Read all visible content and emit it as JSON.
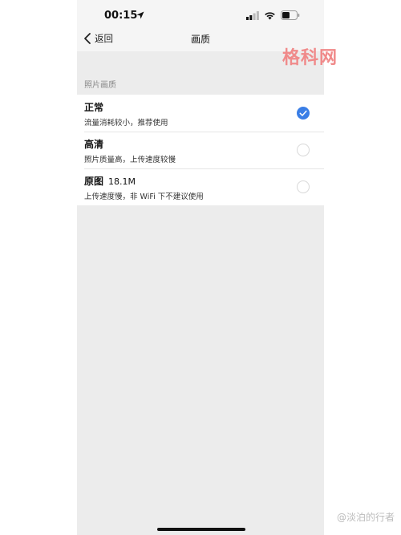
{
  "status_bar": {
    "time": "00:15",
    "icons": [
      "location-arrow-icon",
      "cellular-signal-icon",
      "wifi-icon",
      "battery-icon"
    ]
  },
  "nav": {
    "back_label": "返回",
    "title": "画质"
  },
  "section": {
    "header": "照片画质"
  },
  "options": [
    {
      "title": "正常",
      "size": "",
      "subtitle": "流量消耗较小，推荐使用",
      "selected": true
    },
    {
      "title": "高清",
      "size": "",
      "subtitle": "照片质量高，上传速度较慢",
      "selected": false
    },
    {
      "title": "原图",
      "size": "18.1M",
      "subtitle": "上传速度慢，非 WiFi 下不建议使用",
      "selected": false
    }
  ],
  "watermark": "格科网",
  "credit": "@淡泊的行者",
  "colors": {
    "accent": "#3a7ee6",
    "watermark": "#f08a8a"
  }
}
